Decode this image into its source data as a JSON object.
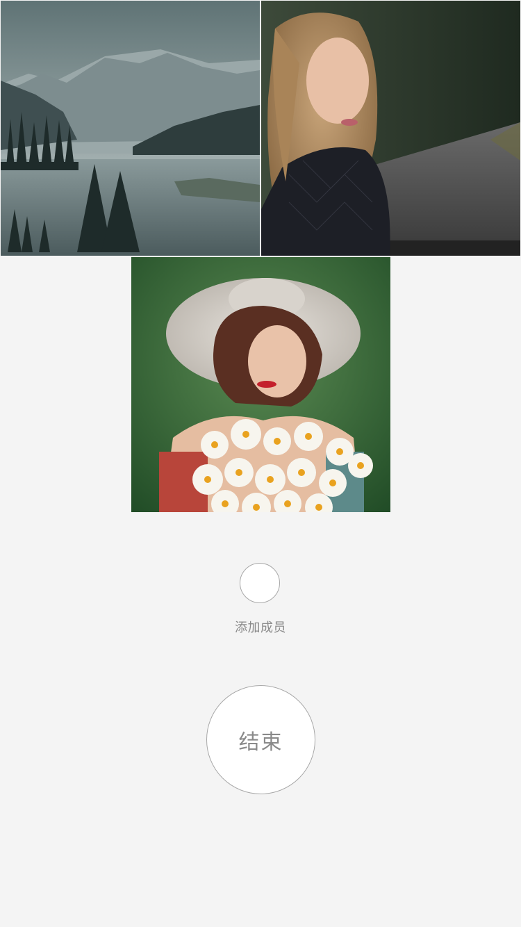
{
  "participants": [
    {
      "name": "",
      "image": "mountain-lake-photo"
    },
    {
      "name": "",
      "image": "blonde-woman-portrait-photo"
    },
    {
      "name": "",
      "image": "woman-with-hat-and-daisies-photo"
    }
  ],
  "add_member": {
    "label": "添加成员",
    "icon": "empty-circle"
  },
  "end_call": {
    "label": "结束"
  },
  "colors": {
    "background": "#f4f4f4",
    "button_border": "#a8a8a8",
    "text": "#8a8a8a"
  }
}
